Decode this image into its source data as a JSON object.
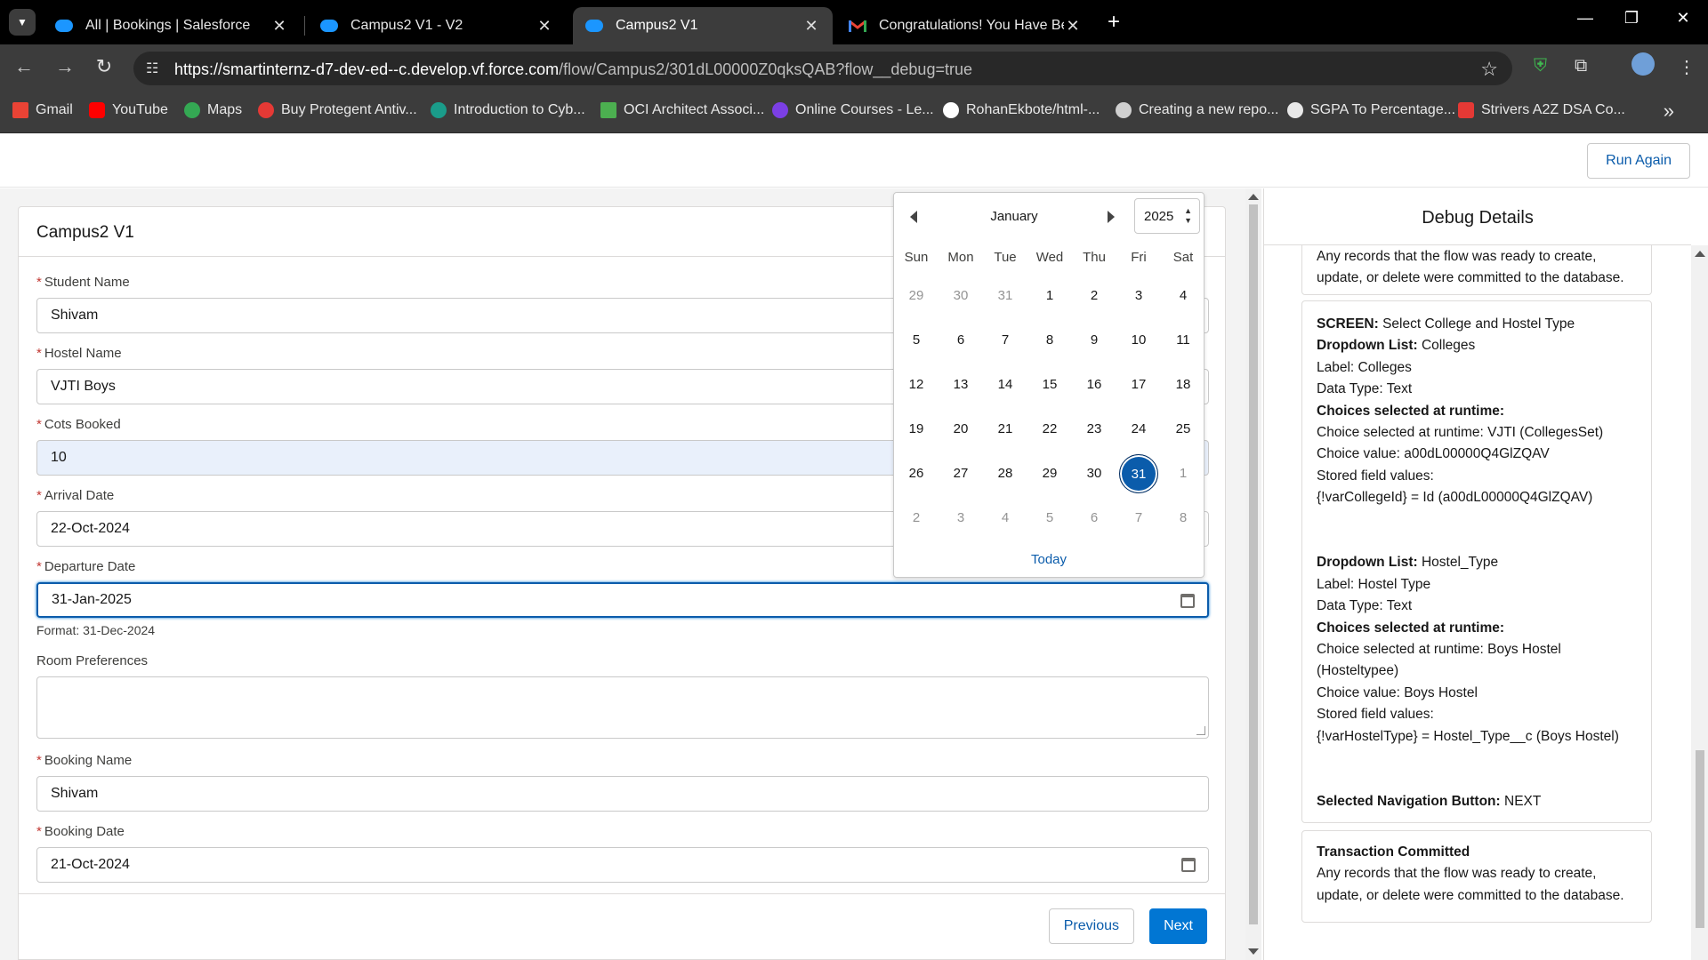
{
  "browser": {
    "tabs": [
      {
        "title": "All | Bookings | Salesforce",
        "icon": "salesforce-cloud-icon"
      },
      {
        "title": "Campus2 V1 - V2",
        "icon": "salesforce-cloud-icon"
      },
      {
        "title": "Campus2 V1",
        "icon": "salesforce-cloud-icon",
        "active": true
      },
      {
        "title": "Congratulations! You Have Been",
        "icon": "gmail-icon"
      }
    ],
    "url_host": "https://smartinternz-d7-dev-ed--c.develop.vf.force.com",
    "url_path": "/flow/Campus2/301dL00000Z0qksQAB?flow__debug=true",
    "bookmarks": [
      {
        "label": "Gmail",
        "color": "#ea4335"
      },
      {
        "label": "YouTube",
        "color": "#ff0000"
      },
      {
        "label": "Maps",
        "color": "#34a853"
      },
      {
        "label": "Buy Protegent Antiv...",
        "color": "#e53935"
      },
      {
        "label": "Introduction to Cyb...",
        "color": "#1a9c8a"
      },
      {
        "label": "OCI Architect Associ...",
        "color": "#4caf50"
      },
      {
        "label": "Online Courses - Le...",
        "color": "#7b3fe4"
      },
      {
        "label": "RohanEkbote/html-...",
        "color": "#ffffff"
      },
      {
        "label": "Creating a new repo...",
        "color": "#d0d0d0"
      },
      {
        "label": "SGPA To Percentage...",
        "color": "#e8e8e8"
      },
      {
        "label": "Strivers A2Z DSA Co...",
        "color": "#e53935"
      }
    ]
  },
  "page": {
    "run_again": "Run Again",
    "flow_title": "Campus2 V1",
    "fields": {
      "student_name": {
        "label": "Student Name",
        "value": "Shivam"
      },
      "hostel_name": {
        "label": "Hostel Name",
        "value": "VJTI Boys"
      },
      "cots_booked": {
        "label": "Cots Booked",
        "value": "10"
      },
      "arrival_date": {
        "label": "Arrival Date",
        "value": "22-Oct-2024"
      },
      "departure_date": {
        "label": "Departure Date",
        "value": "31-Jan-2025",
        "help": "Format: 31-Dec-2024"
      },
      "room_preferences": {
        "label": "Room Preferences",
        "value": ""
      },
      "booking_name": {
        "label": "Booking Name",
        "value": "Shivam"
      },
      "booking_date": {
        "label": "Booking Date",
        "value": "21-Oct-2024"
      }
    },
    "buttons": {
      "previous": "Previous",
      "next": "Next"
    }
  },
  "datepicker": {
    "month": "January",
    "year": "2025",
    "weekdays": [
      "Sun",
      "Mon",
      "Tue",
      "Wed",
      "Thu",
      "Fri",
      "Sat"
    ],
    "weeks": [
      [
        "29",
        "30",
        "31",
        "1",
        "2",
        "3",
        "4"
      ],
      [
        "5",
        "6",
        "7",
        "8",
        "9",
        "10",
        "11"
      ],
      [
        "12",
        "13",
        "14",
        "15",
        "16",
        "17",
        "18"
      ],
      [
        "19",
        "20",
        "21",
        "22",
        "23",
        "24",
        "25"
      ],
      [
        "26",
        "27",
        "28",
        "29",
        "30",
        "31",
        "1"
      ],
      [
        "2",
        "3",
        "4",
        "5",
        "6",
        "7",
        "8"
      ]
    ],
    "selected": "31",
    "today_label": "Today"
  },
  "debug": {
    "title": "Debug Details",
    "card1_lines": [
      "Any records that the flow was ready to create,",
      "update, or delete were committed to the database."
    ],
    "card2": {
      "screen_label": "SCREEN:",
      "screen_value": "Select College and Hostel Type",
      "dd1_label": "Dropdown List:",
      "dd1_value": "Colleges",
      "dd1_lines": [
        "Label: Colleges",
        "Data Type: Text"
      ],
      "choices_label": "Choices selected at runtime:",
      "dd1_choice_lines": [
        "Choice selected at runtime: VJTI (CollegesSet)",
        "Choice value: a00dL00000Q4GlZQAV",
        "Stored field values:",
        "{!varCollegeId} = Id (a00dL00000Q4GlZQAV)"
      ],
      "dd2_label": "Dropdown List:",
      "dd2_value": "Hostel_Type",
      "dd2_lines": [
        "Label: Hostel Type",
        "Data Type: Text"
      ],
      "dd2_choice_lines": [
        "Choice selected at runtime: Boys Hostel",
        "(Hosteltypee)",
        "Choice value: Boys Hostel",
        "Stored field values:",
        "{!varHostelType} = Hostel_Type__c (Boys Hostel)"
      ],
      "nav_label": "Selected Navigation Button:",
      "nav_value": "NEXT"
    },
    "card3": {
      "title": "Transaction Committed",
      "lines": [
        "Any records that the flow was ready to create,",
        "update, or delete were committed to the database."
      ]
    }
  }
}
